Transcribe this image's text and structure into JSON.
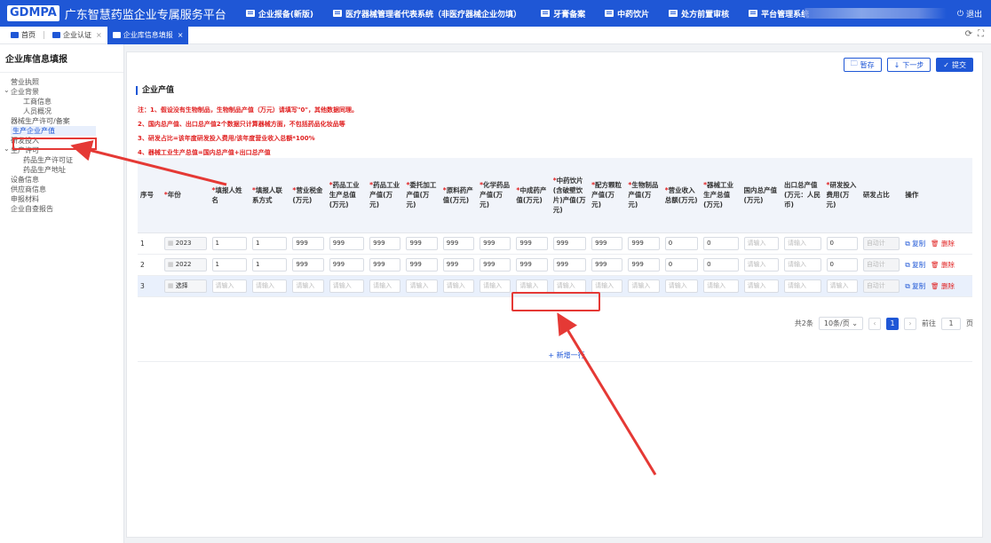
{
  "app": {
    "logo": "GDMPA",
    "title": "广东智慧药监企业专属服务平台",
    "nav": [
      "企业报备(新版)",
      "医疗器械管理者代表系统（非医疗器械企业勿填）",
      "牙膏备案",
      "中药饮片",
      "处方前置审核",
      "平台管理系统"
    ],
    "logout": "退出"
  },
  "tabs": [
    {
      "label": "首页",
      "closable": false
    },
    {
      "label": "企业认证",
      "closable": true
    },
    {
      "label": "企业库信息填报",
      "closable": true
    }
  ],
  "sidebar": {
    "title": "企业库信息填报",
    "items": [
      {
        "label": "营业执照",
        "level": 1
      },
      {
        "label": "企业背景",
        "level": 1,
        "group": true
      },
      {
        "label": "工商信息",
        "level": 2
      },
      {
        "label": "人员概况",
        "level": 2
      },
      {
        "label": "器械生产许可/备案",
        "level": 1
      },
      {
        "label": "生产企业产值",
        "level": 1,
        "active": true
      },
      {
        "label": "研发投入",
        "level": 1
      },
      {
        "label": "生产许可",
        "level": 1,
        "group": true
      },
      {
        "label": "药品生产许可证",
        "level": 2
      },
      {
        "label": "药品生产地址",
        "level": 2
      },
      {
        "label": "设备信息",
        "level": 1
      },
      {
        "label": "供应商信息",
        "level": 1
      },
      {
        "label": "申报材料",
        "level": 1
      },
      {
        "label": "企业自查报告",
        "level": 1
      }
    ]
  },
  "actions": {
    "save": "暂存",
    "next": "下一步",
    "submit": "提交"
  },
  "section": {
    "title": "企业产值",
    "notes": [
      "注：1、假设没有生物制品，生物制品产值（万元）请填写\"0\"，其他数据同理。",
      "2、国内总产值、出口总产值2个数据只计算器械方面，不包括药品化妆品等",
      "3、研发占比=该年度研发投入费用/该年度营业收入总额*100%",
      "4、器械工业生产总值=国内总产值+出口总产值"
    ]
  },
  "table": {
    "headers": [
      {
        "label": "序号",
        "req": false
      },
      {
        "label": "年份",
        "req": true
      },
      {
        "label": "填报人姓名",
        "req": true
      },
      {
        "label": "填报人联系方式",
        "req": true
      },
      {
        "label": "营业税金(万元)",
        "req": true
      },
      {
        "label": "药品工业生产总值(万元)",
        "req": true
      },
      {
        "label": "药品工业产值(万元)",
        "req": true
      },
      {
        "label": "委托加工产值(万元)",
        "req": true
      },
      {
        "label": "原料药产值(万元)",
        "req": true
      },
      {
        "label": "化学药品产值(万元)",
        "req": true
      },
      {
        "label": "中成药产值(万元)",
        "req": true
      },
      {
        "label": "中药饮片(含破壁饮片)产值(万元)",
        "req": true
      },
      {
        "label": "配方颗粒产值(万元)",
        "req": true
      },
      {
        "label": "生物制品产值(万元)",
        "req": true
      },
      {
        "label": "营业收入总额(万元)",
        "req": true
      },
      {
        "label": "器械工业生产总值(万元)",
        "req": true
      },
      {
        "label": "国内总产值(万元)",
        "req": false
      },
      {
        "label": "出口总产值(万元：人民币)",
        "req": false
      },
      {
        "label": "研发投入费用(万元)",
        "req": true
      },
      {
        "label": "研发占比",
        "req": false
      },
      {
        "label": "操作",
        "req": false
      }
    ],
    "rows": [
      {
        "no": "1",
        "year": "2023",
        "cells": [
          "1",
          "1",
          "999",
          "999",
          "999",
          "999",
          "999",
          "999",
          "999",
          "999",
          "999",
          "999",
          "0",
          "0",
          "请输入",
          "请输入",
          "0"
        ],
        "ratio": "自动计",
        "highlight": false
      },
      {
        "no": "2",
        "year": "2022",
        "cells": [
          "1",
          "1",
          "999",
          "999",
          "999",
          "999",
          "999",
          "999",
          "999",
          "999",
          "999",
          "999",
          "0",
          "0",
          "请输入",
          "请输入",
          "0"
        ],
        "ratio": "自动计",
        "highlight": false
      },
      {
        "no": "3",
        "year": "选择",
        "cells": [
          "请输入",
          "请输入",
          "请输入",
          "请输入",
          "请输入",
          "请输入",
          "请输入",
          "请输入",
          "请输入",
          "请输入",
          "请输入",
          "请输入",
          "请输入",
          "请输入",
          "请输入",
          "请输入",
          "请输入"
        ],
        "ratio": "自动计",
        "highlight": true
      }
    ],
    "copy_label": "复制",
    "delete_label": "删除",
    "add_row": "+ 新增一行"
  },
  "pager": {
    "total": "共2条",
    "page_size": "10条/页",
    "current": "1",
    "goto_label": "前往",
    "goto_value": "1",
    "page_unit": "页"
  },
  "colors": {
    "primary": "#1f57d6",
    "danger": "#e02020",
    "annotation": "#e53935"
  }
}
